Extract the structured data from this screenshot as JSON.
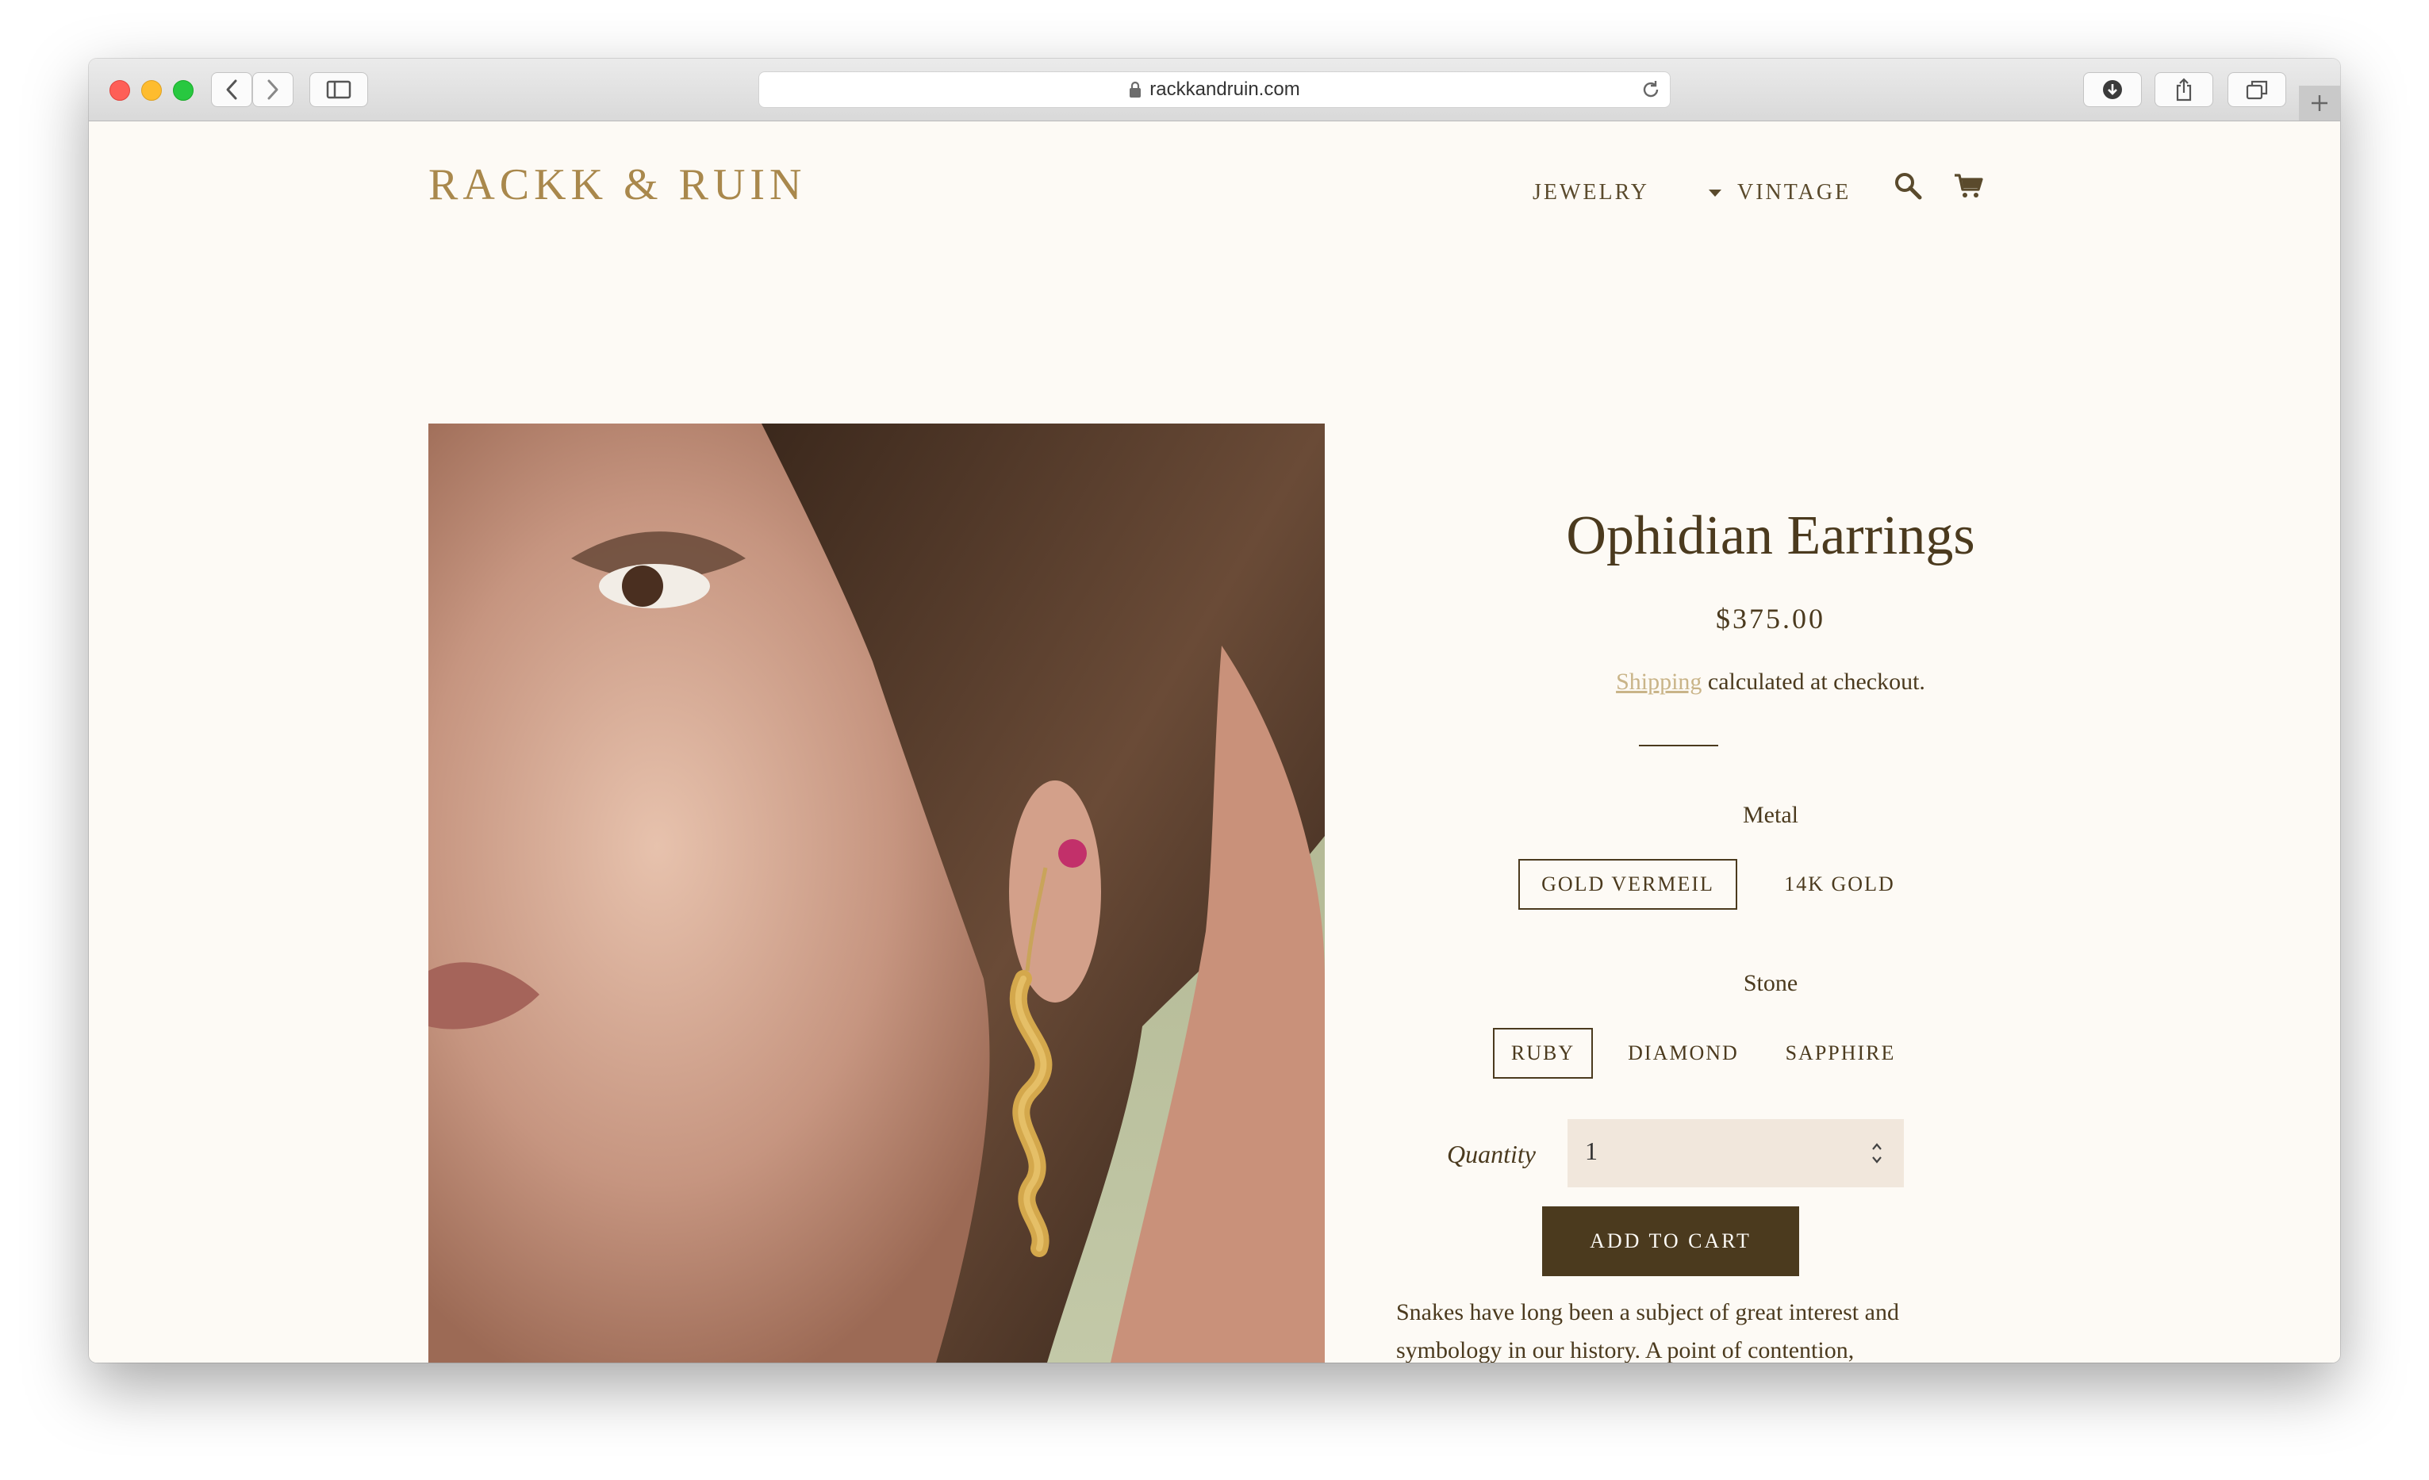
{
  "browser": {
    "url": "rackkandruin.com"
  },
  "site": {
    "logo": "RACKK & RUIN",
    "nav": {
      "jewelry": "JEWELRY",
      "vintage": "VINTAGE"
    }
  },
  "product": {
    "title": "Ophidian Earrings",
    "price": "$375.00",
    "shipping_link": "Shipping",
    "shipping_text": " calculated at checkout.",
    "metal_label": "Metal",
    "metal_options": [
      "GOLD VERMEIL",
      "14K GOLD"
    ],
    "metal_selected": "GOLD VERMEIL",
    "stone_label": "Stone",
    "stone_options": [
      "RUBY",
      "DIAMOND",
      "SAPPHIRE"
    ],
    "stone_selected": "RUBY",
    "quantity_label": "Quantity",
    "quantity_value": "1",
    "add_to_cart": "ADD TO CART",
    "description_line1": "Snakes have long been a subject of great interest and",
    "description_line2": "symbology in our history. A point of contention,"
  },
  "colors": {
    "accent": "#a9884c",
    "text": "#4b3a1e",
    "background": "#fdfaf5",
    "button": "#4b3a1e",
    "qty_field": "#f1e7dc"
  }
}
